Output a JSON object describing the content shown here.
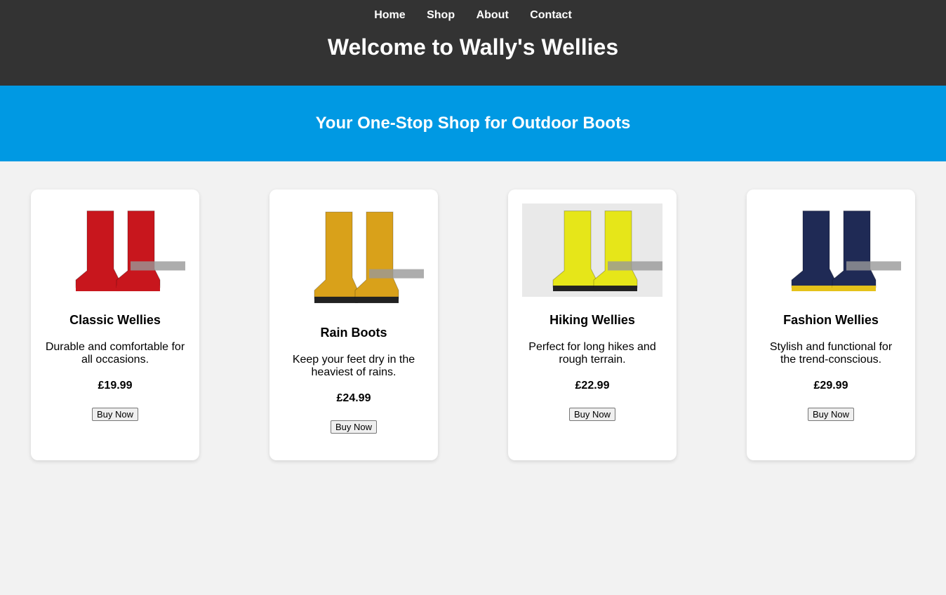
{
  "nav": [
    "Home",
    "Shop",
    "About",
    "Contact"
  ],
  "header": {
    "title": "Welcome to Wally's Wellies"
  },
  "banner": {
    "tagline": "Your One-Stop Shop for Outdoor Boots"
  },
  "colors": {
    "header": "#333333",
    "banner": "#0099e3",
    "background": "#f2f2f2"
  },
  "products": [
    {
      "name": "Classic Wellies",
      "description": "Durable and comfortable for all occasions.",
      "price": "£19.99",
      "button": "Buy Now",
      "boot_color": "#c8161d"
    },
    {
      "name": "Rain Boots",
      "description": "Keep your feet dry in the heaviest of rains.",
      "price": "£24.99",
      "button": "Buy Now",
      "boot_color": "#d9a11a"
    },
    {
      "name": "Hiking Wellies",
      "description": "Perfect for long hikes and rough terrain.",
      "price": "£22.99",
      "button": "Buy Now",
      "boot_color": "#e6e619"
    },
    {
      "name": "Fashion Wellies",
      "description": "Stylish and functional for the trend-conscious.",
      "price": "£29.99",
      "button": "Buy Now",
      "boot_color": "#1f2a55"
    }
  ]
}
